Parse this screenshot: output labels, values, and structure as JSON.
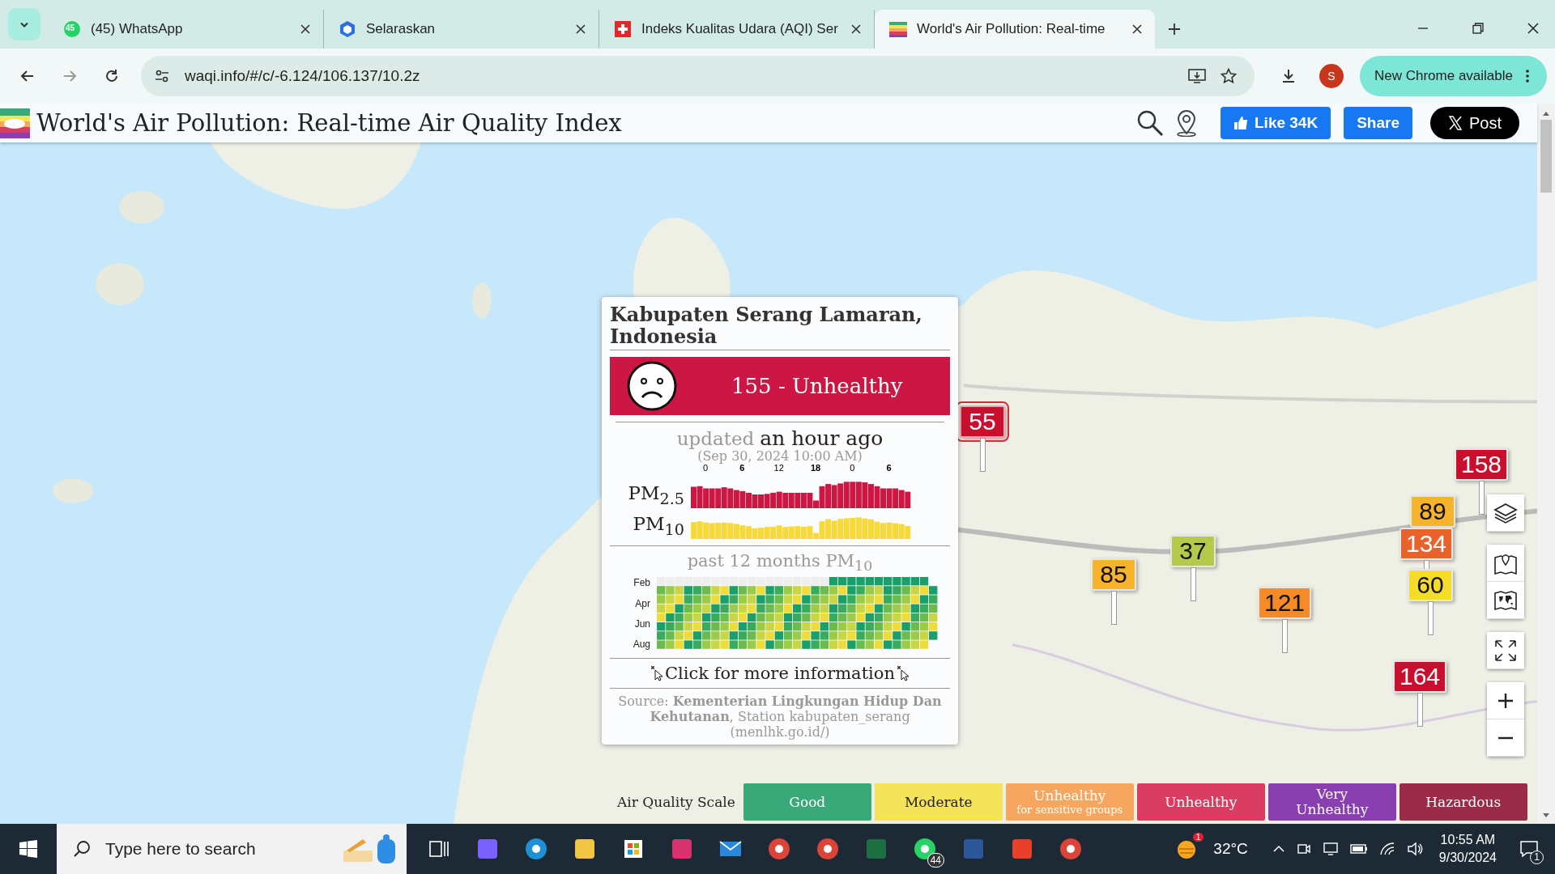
{
  "browser": {
    "tabs": [
      {
        "title": "(45) WhatsApp",
        "badge": "45",
        "selected": false
      },
      {
        "title": "Selaraskan",
        "selected": false
      },
      {
        "title": "Indeks Kualitas Udara (AQI) Ser",
        "selected": false
      },
      {
        "title": "World's Air Pollution: Real-time",
        "selected": true
      }
    ],
    "url": "waqi.info/#/c/-6.124/106.137/10.2z",
    "profile_initial": "S",
    "update_button": "New Chrome available"
  },
  "header": {
    "title": "World's Air Pollution: Real-time Air Quality Index",
    "like_button": "Like 34K",
    "share_button": "Share",
    "post_button": "Post"
  },
  "map": {
    "markers": [
      {
        "value": "55",
        "color": "#c8102e",
        "selected": true
      },
      {
        "value": "158",
        "color": "#c8102e",
        "selected": false
      },
      {
        "value": "89",
        "color": "#f7b32b",
        "selected": false
      },
      {
        "value": "134",
        "color": "#e8622c",
        "selected": false
      },
      {
        "value": "60",
        "color": "#f5dc2c",
        "selected": false
      },
      {
        "value": "85",
        "color": "#f7b32b",
        "selected": false
      },
      {
        "value": "37",
        "color": "#b6c94a",
        "selected": false
      },
      {
        "value": "121",
        "color": "#f58a27",
        "selected": false
      },
      {
        "value": "164",
        "color": "#c8102e",
        "selected": false
      }
    ]
  },
  "popup": {
    "station": "Kabupaten Serang Lamaran, Indonesia",
    "aqi": "155 - Unhealthy",
    "updated_label": "updated",
    "updated": "an hour ago",
    "timestamp": "(Sep 30, 2024 10:00 AM)",
    "hour_ticks": [
      "0",
      "6",
      "12",
      "18",
      "0",
      "6"
    ],
    "pm25_label": "PM$_{2.5}$",
    "pm10_label": "PM$_{10}$",
    "history_title": "past 12 months PM$_{10}$",
    "months": [
      "Feb",
      "Apr",
      "Jun",
      "Aug"
    ],
    "more_info": "Click for more information",
    "source": "Source: **Kementerian Lingkungan Hidup Dan Kehutanan**, Station kabupaten_serang (menlhk.go.id/)"
  },
  "legend": {
    "title": "Air Quality Scale",
    "levels": [
      {
        "label": "Good",
        "color": "#3aa97a"
      },
      {
        "label": "Moderate",
        "color": "#f5e35a"
      },
      {
        "label": "Unhealthy",
        "sublabel": "for sensitive groups",
        "color": "#f6a65e"
      },
      {
        "label": "Unhealthy",
        "color": "#d93d61"
      },
      {
        "label": "Very Unhealthy",
        "color": "#8a3fb0"
      },
      {
        "label": "Hazardous",
        "color": "#9a2c4a"
      }
    ]
  },
  "taskbar": {
    "search_placeholder": "Type here to search",
    "whatsapp_badge": "44",
    "weather_badge": "1",
    "temperature": "32°C",
    "time": "10:55 AM",
    "date": "9/30/2024",
    "notification_count": "1"
  }
}
